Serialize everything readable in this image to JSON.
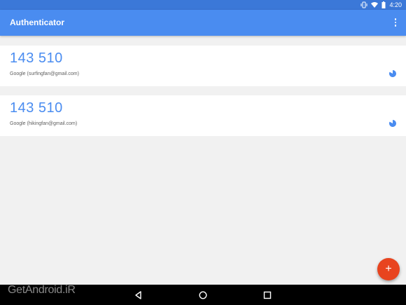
{
  "status_bar": {
    "time": "4:20",
    "icons": [
      "vibrate-icon",
      "wifi-icon",
      "battery-icon"
    ]
  },
  "app_bar": {
    "title": "Authenticator",
    "overflow_icon": "more-vert-icon"
  },
  "accounts": [
    {
      "code": "143 510",
      "label": "Google (surfingfan@gmail.com)"
    },
    {
      "code": "143 510",
      "label": "Google (hikingfan@gmail.com)"
    }
  ],
  "fab": {
    "label": "+"
  },
  "watermark": "GetAndroid.iR",
  "colors": {
    "status_bar": "#3b78d8",
    "app_bar": "#4a8cf0",
    "code_text": "#4a8cf0",
    "fab": "#e8441f",
    "background": "#f1f1f1"
  }
}
